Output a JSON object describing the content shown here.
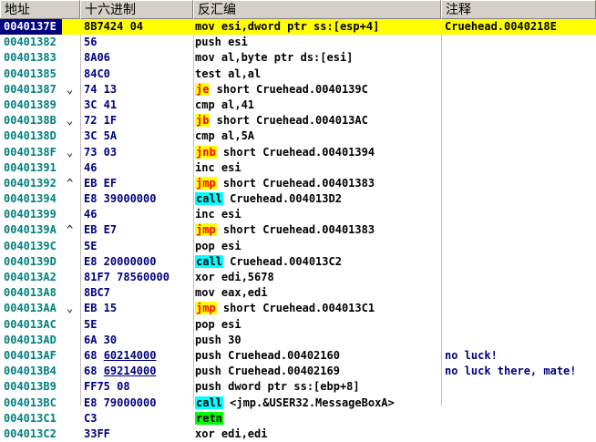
{
  "headers": [
    "地址",
    "十六进制",
    "反汇编",
    "注释"
  ],
  "rows": [
    {
      "addr": "0040137E",
      "arrow": "",
      "hex": "8B7424 04",
      "mn": "",
      "op": "mov esi,dword ptr ss:[esp+4]",
      "cmt": "Cruehead.0040218E",
      "sel": true
    },
    {
      "addr": "00401382",
      "arrow": "",
      "hex": "56",
      "mn": "",
      "op": "push esi",
      "cmt": ""
    },
    {
      "addr": "00401383",
      "arrow": "",
      "hex": "8A06",
      "mn": "",
      "op": "mov al,byte ptr ds:[esi]",
      "cmt": ""
    },
    {
      "addr": "00401385",
      "arrow": "",
      "hex": "84C0",
      "mn": "",
      "op": "test al,al",
      "cmt": ""
    },
    {
      "addr": "00401387",
      "arrow": "⌄",
      "hex": "74 13",
      "mn": "je",
      "op": " short Cruehead.0040139C",
      "cmt": "",
      "mt": "jmp"
    },
    {
      "addr": "00401389",
      "arrow": "",
      "hex": "3C 41",
      "mn": "",
      "op": "cmp al,41",
      "cmt": ""
    },
    {
      "addr": "0040138B",
      "arrow": "⌄",
      "hex": "72 1F",
      "mn": "jb",
      "op": " short Cruehead.004013AC",
      "cmt": "",
      "mt": "jmp"
    },
    {
      "addr": "0040138D",
      "arrow": "",
      "hex": "3C 5A",
      "mn": "",
      "op": "cmp al,5A",
      "cmt": ""
    },
    {
      "addr": "0040138F",
      "arrow": "⌄",
      "hex": "73 03",
      "mn": "jnb",
      "op": " short Cruehead.00401394",
      "cmt": "",
      "mt": "jmp"
    },
    {
      "addr": "00401391",
      "arrow": "",
      "hex": "46",
      "mn": "",
      "op": "inc esi",
      "cmt": ""
    },
    {
      "addr": "00401392",
      "arrow": "^",
      "hex": "EB EF",
      "mn": "jmp",
      "op": " short Cruehead.00401383",
      "cmt": "",
      "mt": "jmp"
    },
    {
      "addr": "00401394",
      "arrow": "",
      "hex": "E8 39000000",
      "mn": "call",
      "op": " Cruehead.004013D2",
      "cmt": "",
      "mt": "call"
    },
    {
      "addr": "00401399",
      "arrow": "",
      "hex": "46",
      "mn": "",
      "op": "inc esi",
      "cmt": ""
    },
    {
      "addr": "0040139A",
      "arrow": "^",
      "hex": "EB E7",
      "mn": "jmp",
      "op": " short Cruehead.00401383",
      "cmt": "",
      "mt": "jmp"
    },
    {
      "addr": "0040139C",
      "arrow": "",
      "hex": "5E",
      "mn": "",
      "op": "pop esi",
      "cmt": ""
    },
    {
      "addr": "0040139D",
      "arrow": "",
      "hex": "E8 20000000",
      "mn": "call",
      "op": " Cruehead.004013C2",
      "cmt": "",
      "mt": "call"
    },
    {
      "addr": "004013A2",
      "arrow": "",
      "hex": "81F7 78560000",
      "mn": "",
      "op": "xor edi,5678",
      "cmt": ""
    },
    {
      "addr": "004013A8",
      "arrow": "",
      "hex": "8BC7",
      "mn": "",
      "op": "mov eax,edi",
      "cmt": ""
    },
    {
      "addr": "004013AA",
      "arrow": "⌄",
      "hex": "EB 15",
      "mn": "jmp",
      "op": " short Cruehead.004013C1",
      "cmt": "",
      "mt": "jmp"
    },
    {
      "addr": "004013AC",
      "arrow": "",
      "hex": "5E",
      "mn": "",
      "op": "pop esi",
      "cmt": ""
    },
    {
      "addr": "004013AD",
      "arrow": "",
      "hex": "6A 30",
      "mn": "",
      "op": "push 30",
      "cmt": ""
    },
    {
      "addr": "004013AF",
      "arrow": "",
      "hex": "68 60214000",
      "hexu": true,
      "mn": "",
      "op": "push Cruehead.00402160",
      "cmt": "no luck!"
    },
    {
      "addr": "004013B4",
      "arrow": "",
      "hex": "68 69214000",
      "hexu": true,
      "mn": "",
      "op": "push Cruehead.00402169",
      "cmt": "no luck there, mate!"
    },
    {
      "addr": "004013B9",
      "arrow": "",
      "hex": "FF75 08",
      "mn": "",
      "op": "push dword ptr ss:[ebp+8]",
      "cmt": ""
    },
    {
      "addr": "004013BC",
      "arrow": "",
      "hex": "E8 79000000",
      "mn": "call",
      "op": " <jmp.&USER32.MessageBoxA>",
      "cmt": "",
      "mt": "call"
    },
    {
      "addr": "004013C1",
      "arrow": "",
      "hex": "C3",
      "mn": "retn",
      "op": "",
      "cmt": "",
      "mt": "retn"
    },
    {
      "addr": "004013C2",
      "arrow": "",
      "hex": "33FF",
      "mn": "",
      "op": "xor edi,edi",
      "cmt": ""
    }
  ]
}
